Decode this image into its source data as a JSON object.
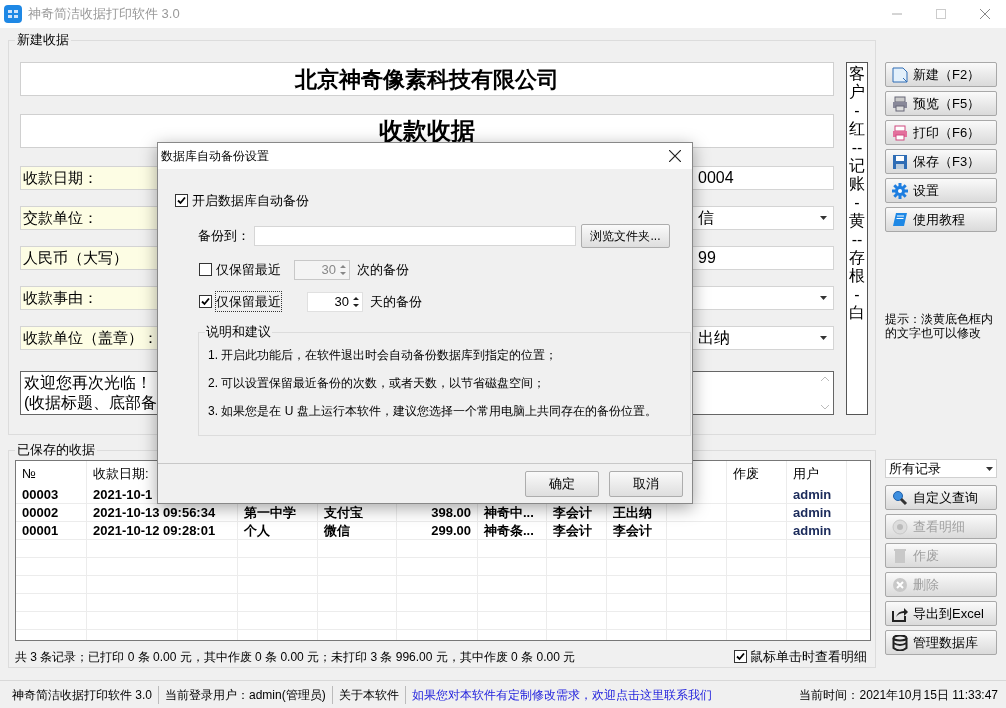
{
  "window": {
    "title": "神奇简洁收据打印软件 3.0"
  },
  "new_receipt": {
    "group_title": "新建收据",
    "company": "北京神奇像素科技有限公司",
    "receipt_title": "收款收据",
    "fields": [
      {
        "label": "收款日期：",
        "value": "0004",
        "kind": "text"
      },
      {
        "label": "交款单位：",
        "value": "信",
        "kind": "dropdown"
      },
      {
        "label": "人民币（大写）",
        "value": "99",
        "kind": "text"
      },
      {
        "label": "收款事由：",
        "kind": "dropdown"
      },
      {
        "label": "收款单位（盖章）：",
        "value": "出纳",
        "kind": "dropdown"
      }
    ],
    "note_lines": [
      "欢迎您再次光临！",
      "(收据标题、底部备"
    ],
    "copy_strip": "客户-红--记账-黄--存根-白"
  },
  "actions": [
    {
      "label": "新建（F2）"
    },
    {
      "label": "预览（F5）"
    },
    {
      "label": "打印（F6）"
    },
    {
      "label": "保存（F3）"
    },
    {
      "label": "设置"
    },
    {
      "label": "使用教程"
    }
  ],
  "hint": "提示：淡黄底色框内的文字也可以修改",
  "saved": {
    "group_title": "已保存的收据",
    "columns": [
      "№",
      "收款日期:",
      null,
      null,
      null,
      null,
      null,
      null,
      null,
      "作废",
      "用户"
    ],
    "rows": [
      [
        "00003",
        "2021-10-1",
        null,
        null,
        null,
        null,
        null,
        null,
        null,
        null,
        "admin"
      ],
      [
        "00002",
        "2021-10-13 09:56:34",
        "第一中学",
        "支付宝",
        "398.00",
        "神奇中...",
        "李会计",
        "王出纳",
        null,
        null,
        "admin"
      ],
      [
        "00001",
        "2021-10-12 09:28:01",
        "个人",
        "微信",
        "299.00",
        "神奇条...",
        "李会计",
        "李会计",
        null,
        null,
        "admin"
      ]
    ],
    "summary": "共 3 条记录；已打印 0 条 0.00 元，其中作废 0 条 0.00 元；未打印 3 条 996.00 元，其中作废 0 条 0.00 元",
    "click_detail": {
      "label": "鼠标单击时查看明细",
      "checked": true
    }
  },
  "filter": {
    "value": "所有记录"
  },
  "record_actions": [
    {
      "label": "自定义查询",
      "disabled": false
    },
    {
      "label": "查看明细",
      "disabled": true
    },
    {
      "label": "作废",
      "disabled": true
    },
    {
      "label": "删除",
      "disabled": true
    },
    {
      "label": "导出到Excel",
      "disabled": false
    },
    {
      "label": "管理数据库",
      "disabled": false
    }
  ],
  "status_bar": [
    {
      "text": "神奇简洁收据打印软件 3.0",
      "kind": "text"
    },
    {
      "text": "当前登录用户：admin(管理员)",
      "kind": "text"
    },
    {
      "text": "关于本软件",
      "kind": "text"
    },
    {
      "text": "如果您对本软件有定制修改需求，欢迎点击这里联系我们",
      "kind": "link"
    }
  ],
  "clock": "当前时间：2021年10月15日 11:33:47",
  "dialog": {
    "title": "数据库自动备份设置",
    "enable": {
      "label": "开启数据库自动备份",
      "checked": true
    },
    "backup_to": {
      "label": "备份到："
    },
    "browse": "浏览文件夹...",
    "keep": [
      {
        "label": "仅保留最近",
        "checked": false,
        "value": "30",
        "unit": "次的备份"
      },
      {
        "label": "仅保留最近",
        "checked": true,
        "value": "30",
        "unit": "天的备份"
      }
    ],
    "notes": {
      "title": "说明和建议",
      "lines": [
        "1. 开启此功能后，在软件退出时会自动备份数据库到指定的位置；",
        "2. 可以设置保留最近备份的次数，或者天数，以节省磁盘空间；",
        "3. 如果您是在 U 盘上运行本软件，建议您选择一个常用电脑上共同存在的备份位置。"
      ]
    },
    "buttons": [
      "确定",
      "取消"
    ]
  }
}
